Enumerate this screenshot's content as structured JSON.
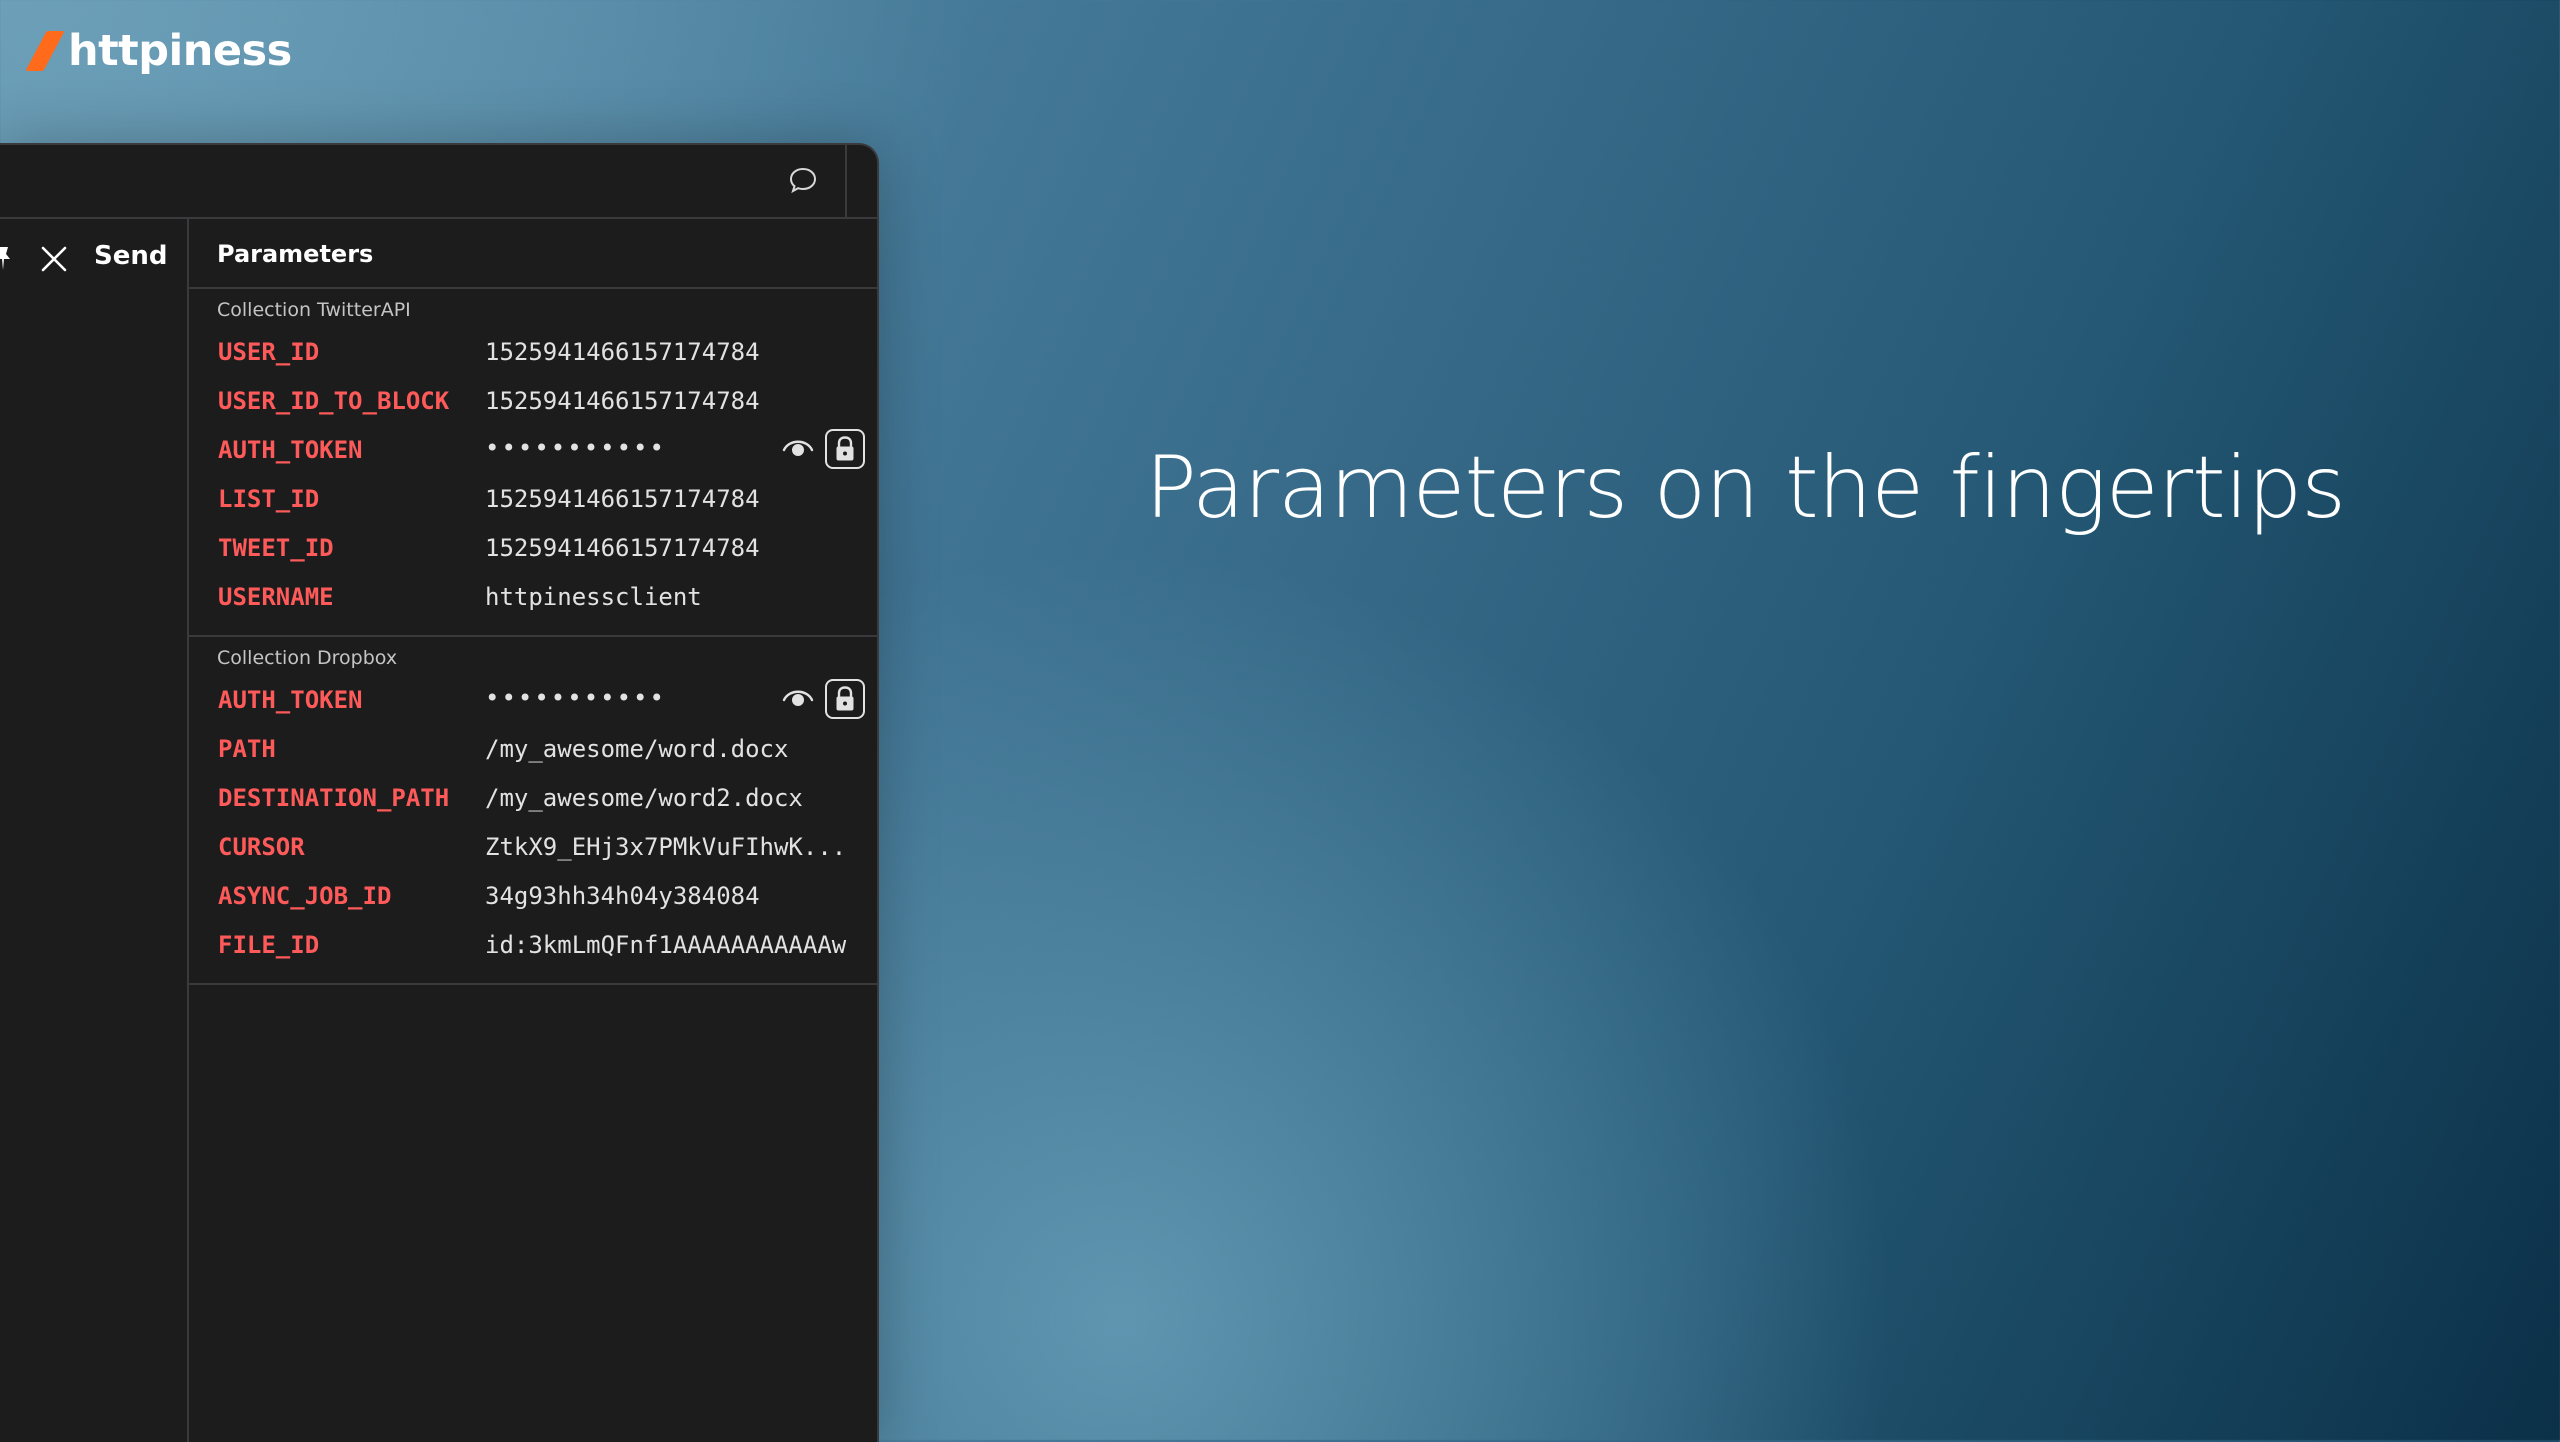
{
  "brand": {
    "name": "httpiness"
  },
  "headline": "Parameters on the fingertips",
  "toolbar": {
    "send_label": "Send"
  },
  "params": {
    "title": "Parameters",
    "groups": [
      {
        "label": "Collection TwitterAPI",
        "rows": [
          {
            "key": "USER_ID",
            "value": "1525941466157174784"
          },
          {
            "key": "USER_ID_TO_BLOCK",
            "value": "1525941466157174784"
          },
          {
            "key": "AUTH_TOKEN",
            "value": "•••••••••••",
            "secret": true
          },
          {
            "key": "LIST_ID",
            "value": "1525941466157174784"
          },
          {
            "key": "TWEET_ID",
            "value": "1525941466157174784"
          },
          {
            "key": "USERNAME",
            "value": "httpinessclient"
          }
        ]
      },
      {
        "label": "Collection Dropbox",
        "rows": [
          {
            "key": "AUTH_TOKEN",
            "value": "•••••••••••",
            "secret": true
          },
          {
            "key": "PATH",
            "value": "/my_awesome/word.docx"
          },
          {
            "key": "DESTINATION_PATH",
            "value": "/my_awesome/word2.docx"
          },
          {
            "key": "CURSOR",
            "value": "ZtkX9_EHj3x7PMkVuFIhwK..."
          },
          {
            "key": "ASYNC_JOB_ID",
            "value": "34g93hh34h04y384084"
          },
          {
            "key": "FILE_ID",
            "value": "id:3kmLmQFnf1AAAAAAAAAAAw"
          }
        ]
      }
    ]
  },
  "icons": {
    "chat": "speech-bubble-icon",
    "pin": "pin-icon",
    "close": "close-icon",
    "reveal": "eye-icon",
    "lock": "lock-icon"
  },
  "colors": {
    "accent": "#ff6b1a",
    "key": "#ff5a5a",
    "panel": "#1c1c1d"
  }
}
